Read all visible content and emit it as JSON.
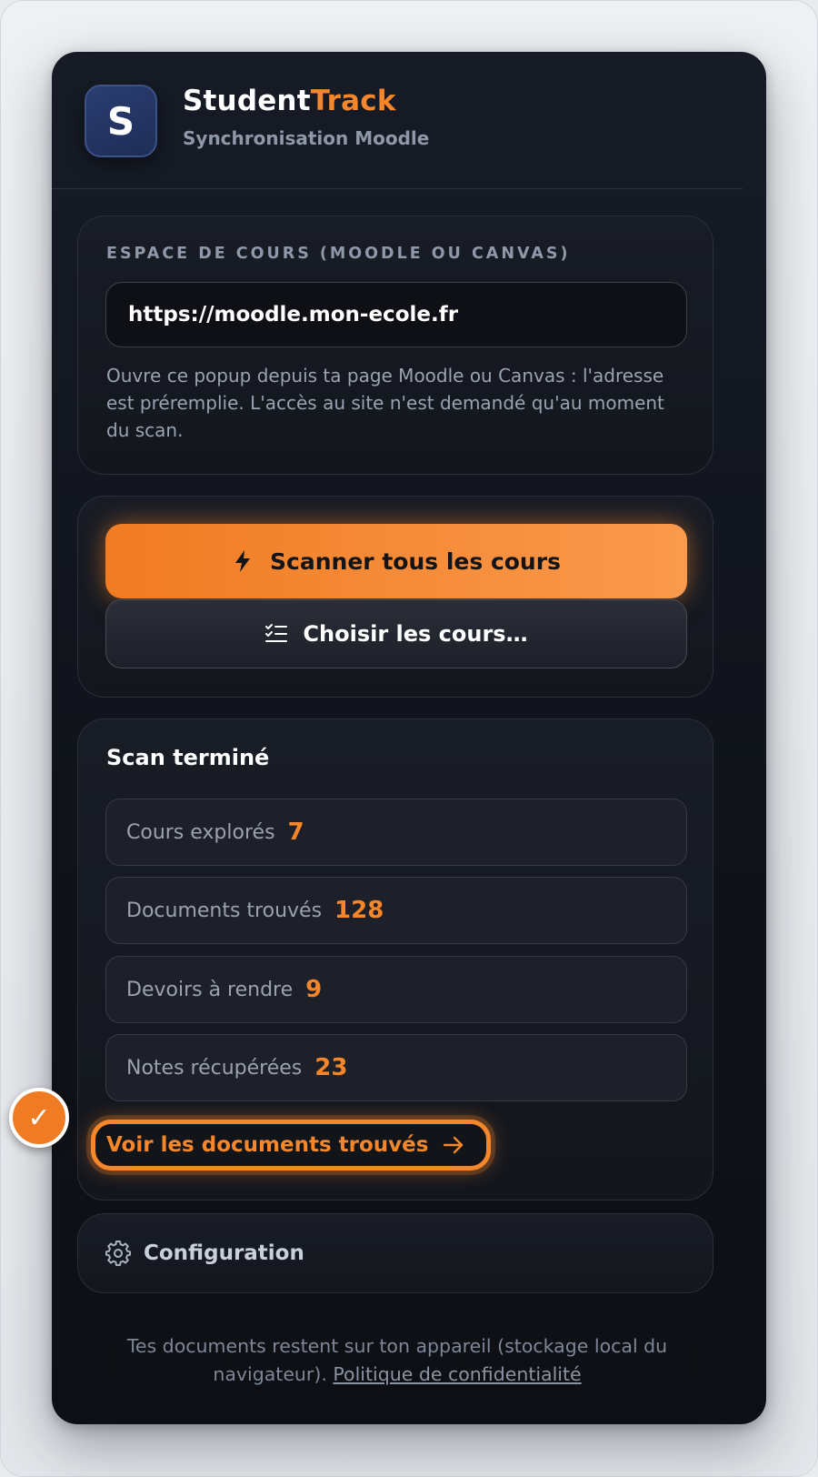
{
  "header": {
    "logo_letter": "S",
    "brand_main": "Student",
    "brand_accent": "Track",
    "subtitle": "Synchronisation Moodle"
  },
  "course_space": {
    "label": "ESPACE DE COURS (MOODLE OU CANVAS)",
    "url_value": "https://moodle.mon-ecole.fr",
    "help_text": "Ouvre ce popup depuis ta page Moodle ou Canvas : l'adresse est préremplie. L'accès au site n'est demandé qu'au moment du scan."
  },
  "actions": {
    "scan_label": "Scanner tous les cours",
    "choose_label": "Choisir les cours…"
  },
  "results": {
    "title": "Scan terminé",
    "stats": [
      {
        "label": "Cours explorés",
        "value": "7"
      },
      {
        "label": "Documents trouvés",
        "value": "128"
      },
      {
        "label": "Devoirs à rendre",
        "value": "9"
      },
      {
        "label": "Notes récupérées",
        "value": "23"
      }
    ],
    "view_button": "Voir les documents trouvés",
    "badge": "✓"
  },
  "config": {
    "label": "Configuration"
  },
  "footer": {
    "text": "Tes documents restent sur ton appareil (stockage local du navigateur).",
    "link": "Politique de confidentialité"
  },
  "colors": {
    "accent": "#f5862a",
    "background": "#10131a"
  }
}
